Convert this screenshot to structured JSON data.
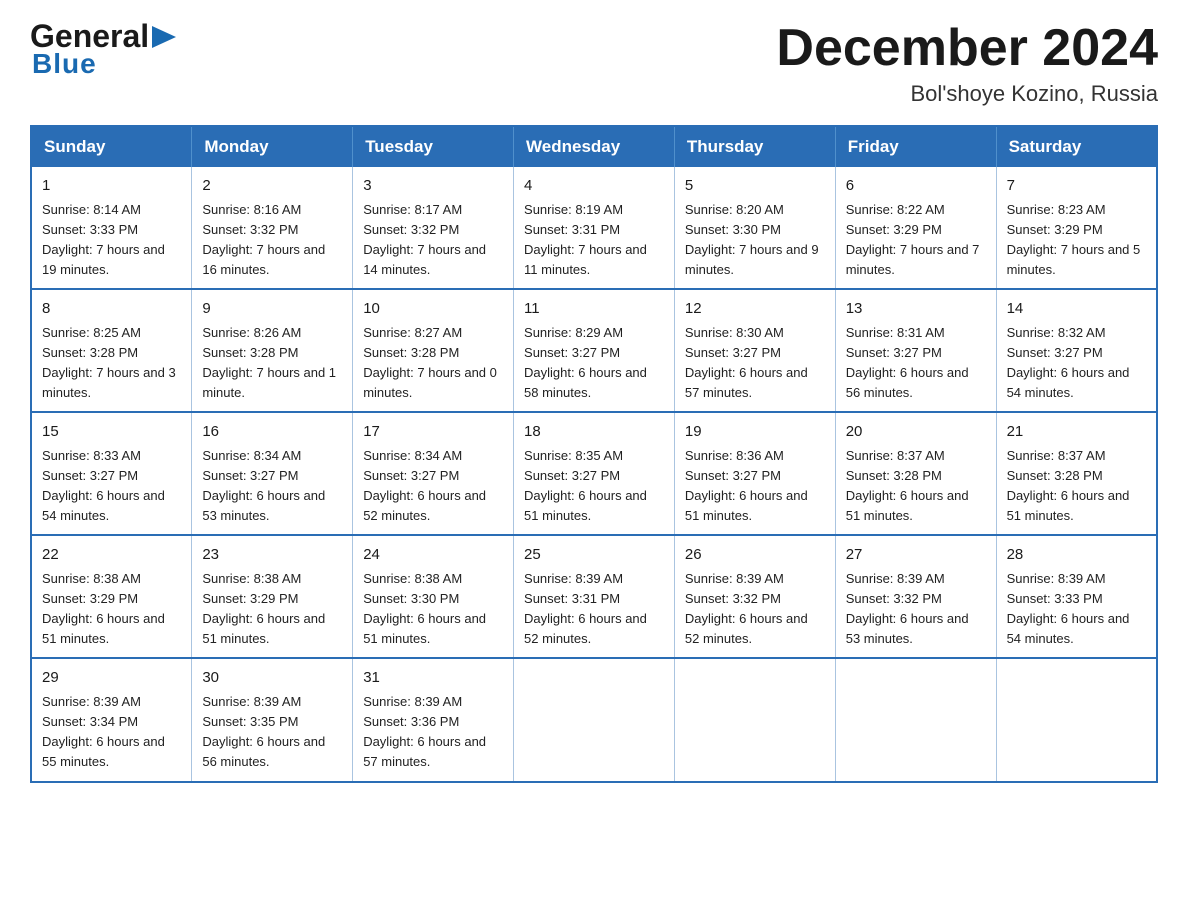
{
  "logo": {
    "general": "General",
    "blue": "Blue",
    "underline": "Blue"
  },
  "title": {
    "month": "December 2024",
    "location": "Bol'shoye Kozino, Russia"
  },
  "header": {
    "days": [
      "Sunday",
      "Monday",
      "Tuesday",
      "Wednesday",
      "Thursday",
      "Friday",
      "Saturday"
    ]
  },
  "weeks": [
    [
      {
        "day": "1",
        "sunrise": "8:14 AM",
        "sunset": "3:33 PM",
        "daylight": "7 hours and 19 minutes."
      },
      {
        "day": "2",
        "sunrise": "8:16 AM",
        "sunset": "3:32 PM",
        "daylight": "7 hours and 16 minutes."
      },
      {
        "day": "3",
        "sunrise": "8:17 AM",
        "sunset": "3:32 PM",
        "daylight": "7 hours and 14 minutes."
      },
      {
        "day": "4",
        "sunrise": "8:19 AM",
        "sunset": "3:31 PM",
        "daylight": "7 hours and 11 minutes."
      },
      {
        "day": "5",
        "sunrise": "8:20 AM",
        "sunset": "3:30 PM",
        "daylight": "7 hours and 9 minutes."
      },
      {
        "day": "6",
        "sunrise": "8:22 AM",
        "sunset": "3:29 PM",
        "daylight": "7 hours and 7 minutes."
      },
      {
        "day": "7",
        "sunrise": "8:23 AM",
        "sunset": "3:29 PM",
        "daylight": "7 hours and 5 minutes."
      }
    ],
    [
      {
        "day": "8",
        "sunrise": "8:25 AM",
        "sunset": "3:28 PM",
        "daylight": "7 hours and 3 minutes."
      },
      {
        "day": "9",
        "sunrise": "8:26 AM",
        "sunset": "3:28 PM",
        "daylight": "7 hours and 1 minute."
      },
      {
        "day": "10",
        "sunrise": "8:27 AM",
        "sunset": "3:28 PM",
        "daylight": "7 hours and 0 minutes."
      },
      {
        "day": "11",
        "sunrise": "8:29 AM",
        "sunset": "3:27 PM",
        "daylight": "6 hours and 58 minutes."
      },
      {
        "day": "12",
        "sunrise": "8:30 AM",
        "sunset": "3:27 PM",
        "daylight": "6 hours and 57 minutes."
      },
      {
        "day": "13",
        "sunrise": "8:31 AM",
        "sunset": "3:27 PM",
        "daylight": "6 hours and 56 minutes."
      },
      {
        "day": "14",
        "sunrise": "8:32 AM",
        "sunset": "3:27 PM",
        "daylight": "6 hours and 54 minutes."
      }
    ],
    [
      {
        "day": "15",
        "sunrise": "8:33 AM",
        "sunset": "3:27 PM",
        "daylight": "6 hours and 54 minutes."
      },
      {
        "day": "16",
        "sunrise": "8:34 AM",
        "sunset": "3:27 PM",
        "daylight": "6 hours and 53 minutes."
      },
      {
        "day": "17",
        "sunrise": "8:34 AM",
        "sunset": "3:27 PM",
        "daylight": "6 hours and 52 minutes."
      },
      {
        "day": "18",
        "sunrise": "8:35 AM",
        "sunset": "3:27 PM",
        "daylight": "6 hours and 51 minutes."
      },
      {
        "day": "19",
        "sunrise": "8:36 AM",
        "sunset": "3:27 PM",
        "daylight": "6 hours and 51 minutes."
      },
      {
        "day": "20",
        "sunrise": "8:37 AM",
        "sunset": "3:28 PM",
        "daylight": "6 hours and 51 minutes."
      },
      {
        "day": "21",
        "sunrise": "8:37 AM",
        "sunset": "3:28 PM",
        "daylight": "6 hours and 51 minutes."
      }
    ],
    [
      {
        "day": "22",
        "sunrise": "8:38 AM",
        "sunset": "3:29 PM",
        "daylight": "6 hours and 51 minutes."
      },
      {
        "day": "23",
        "sunrise": "8:38 AM",
        "sunset": "3:29 PM",
        "daylight": "6 hours and 51 minutes."
      },
      {
        "day": "24",
        "sunrise": "8:38 AM",
        "sunset": "3:30 PM",
        "daylight": "6 hours and 51 minutes."
      },
      {
        "day": "25",
        "sunrise": "8:39 AM",
        "sunset": "3:31 PM",
        "daylight": "6 hours and 52 minutes."
      },
      {
        "day": "26",
        "sunrise": "8:39 AM",
        "sunset": "3:32 PM",
        "daylight": "6 hours and 52 minutes."
      },
      {
        "day": "27",
        "sunrise": "8:39 AM",
        "sunset": "3:32 PM",
        "daylight": "6 hours and 53 minutes."
      },
      {
        "day": "28",
        "sunrise": "8:39 AM",
        "sunset": "3:33 PM",
        "daylight": "6 hours and 54 minutes."
      }
    ],
    [
      {
        "day": "29",
        "sunrise": "8:39 AM",
        "sunset": "3:34 PM",
        "daylight": "6 hours and 55 minutes."
      },
      {
        "day": "30",
        "sunrise": "8:39 AM",
        "sunset": "3:35 PM",
        "daylight": "6 hours and 56 minutes."
      },
      {
        "day": "31",
        "sunrise": "8:39 AM",
        "sunset": "3:36 PM",
        "daylight": "6 hours and 57 minutes."
      },
      null,
      null,
      null,
      null
    ]
  ]
}
